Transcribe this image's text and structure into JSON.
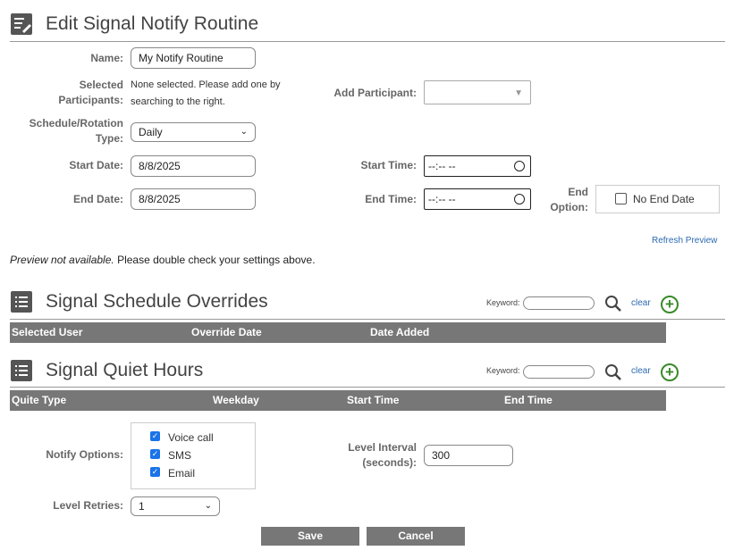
{
  "page": {
    "title": "Edit Signal Notify Routine"
  },
  "form": {
    "name_label": "Name:",
    "name_value": "My Notify Routine",
    "selected_participants_label_1": "Selected",
    "selected_participants_label_2": "Participants:",
    "selected_participants_text_1": "None selected. Please add one by",
    "selected_participants_text_2": "searching to the right.",
    "add_participant_label": "Add Participant:",
    "add_participant_value": "",
    "schedule_type_label_1": "Schedule/Rotation",
    "schedule_type_label_2": "Type:",
    "schedule_type_value": "Daily",
    "start_date_label": "Start Date:",
    "start_date_value": "8/8/2025",
    "start_time_label": "Start Time:",
    "start_time_value": "--:-- --",
    "end_date_label": "End Date:",
    "end_date_value": "8/8/2025",
    "end_time_label": "End Time:",
    "end_time_value": "--:-- --",
    "end_option_label_1": "End",
    "end_option_label_2": "Option:",
    "no_end_date_label": "No End Date",
    "refresh_preview": "Refresh Preview",
    "preview_italic": "Preview not available.",
    "preview_rest": " Please double check your settings above."
  },
  "overrides": {
    "title": "Signal Schedule Overrides",
    "keyword_label": "Keyword:",
    "clear": "clear",
    "columns": [
      "Selected User",
      "Override Date",
      "Date Added"
    ]
  },
  "quiet_hours": {
    "title": "Signal Quiet Hours",
    "keyword_label": "Keyword:",
    "clear": "clear",
    "columns": [
      "Quite Type",
      "Weekday",
      "Start Time",
      "End Time"
    ]
  },
  "notify": {
    "options_label": "Notify Options:",
    "options": [
      {
        "label": "Voice call",
        "checked": true
      },
      {
        "label": "SMS",
        "checked": true
      },
      {
        "label": "Email",
        "checked": true
      }
    ],
    "level_interval_label_1": "Level Interval",
    "level_interval_label_2": "(seconds):",
    "level_interval_value": "300",
    "level_retries_label": "Level Retries:",
    "level_retries_value": "1"
  },
  "buttons": {
    "save": "Save",
    "cancel": "Cancel"
  },
  "colors": {
    "grid_header": "#777777",
    "link": "#2a6ab0",
    "add_green": "#3a8a2a",
    "checkbox": "#1a73e8"
  }
}
